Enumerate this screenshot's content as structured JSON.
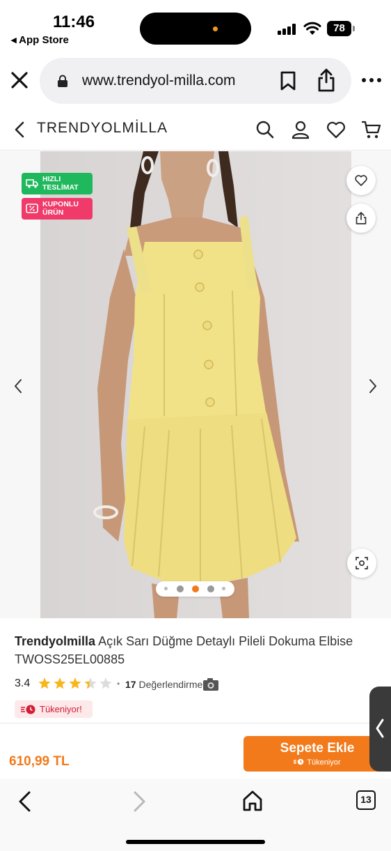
{
  "status_bar": {
    "time": "11:46",
    "back_app": "◂ App Store",
    "battery": "78"
  },
  "browser": {
    "url": "www.trendyol-milla.com",
    "icons": [
      "close-icon",
      "lock-icon",
      "bookmark-icon",
      "share-icon",
      "more-icon"
    ]
  },
  "site_header": {
    "brand": "TRENDYOLMİLLA",
    "icons": [
      "back-icon",
      "search-icon",
      "user-icon",
      "heart-icon",
      "cart-icon"
    ]
  },
  "gallery": {
    "badges": [
      {
        "line1": "HIZLI",
        "line2": "TESLİMAT",
        "color": "#1fb85c"
      },
      {
        "line1": "KUPONLU",
        "line2": "ÜRÜN",
        "color": "#ef3a6a"
      }
    ],
    "image_count": 4,
    "active_index": 2
  },
  "product": {
    "brand": "Trendyolmilla",
    "name": "Açık Sarı Düğme Detaylı Pileli Dokuma Elbise TWOSS25EL00885",
    "rating": "3.4",
    "rating_value": 3.4,
    "review_count": "17",
    "review_label": "Değerlendirme",
    "stock_tag": "Tükeniyor!"
  },
  "buy_bar": {
    "price": "610,99 TL",
    "cart_button": "Sepete Ekle",
    "cart_sub": "Tükeniyor"
  },
  "toolbar": {
    "tab_count": "13"
  },
  "colors": {
    "accent": "#f27a1a",
    "green_badge": "#1fb85c",
    "pink_badge": "#ef3a6a",
    "dress_yellow": "#f2e287"
  }
}
